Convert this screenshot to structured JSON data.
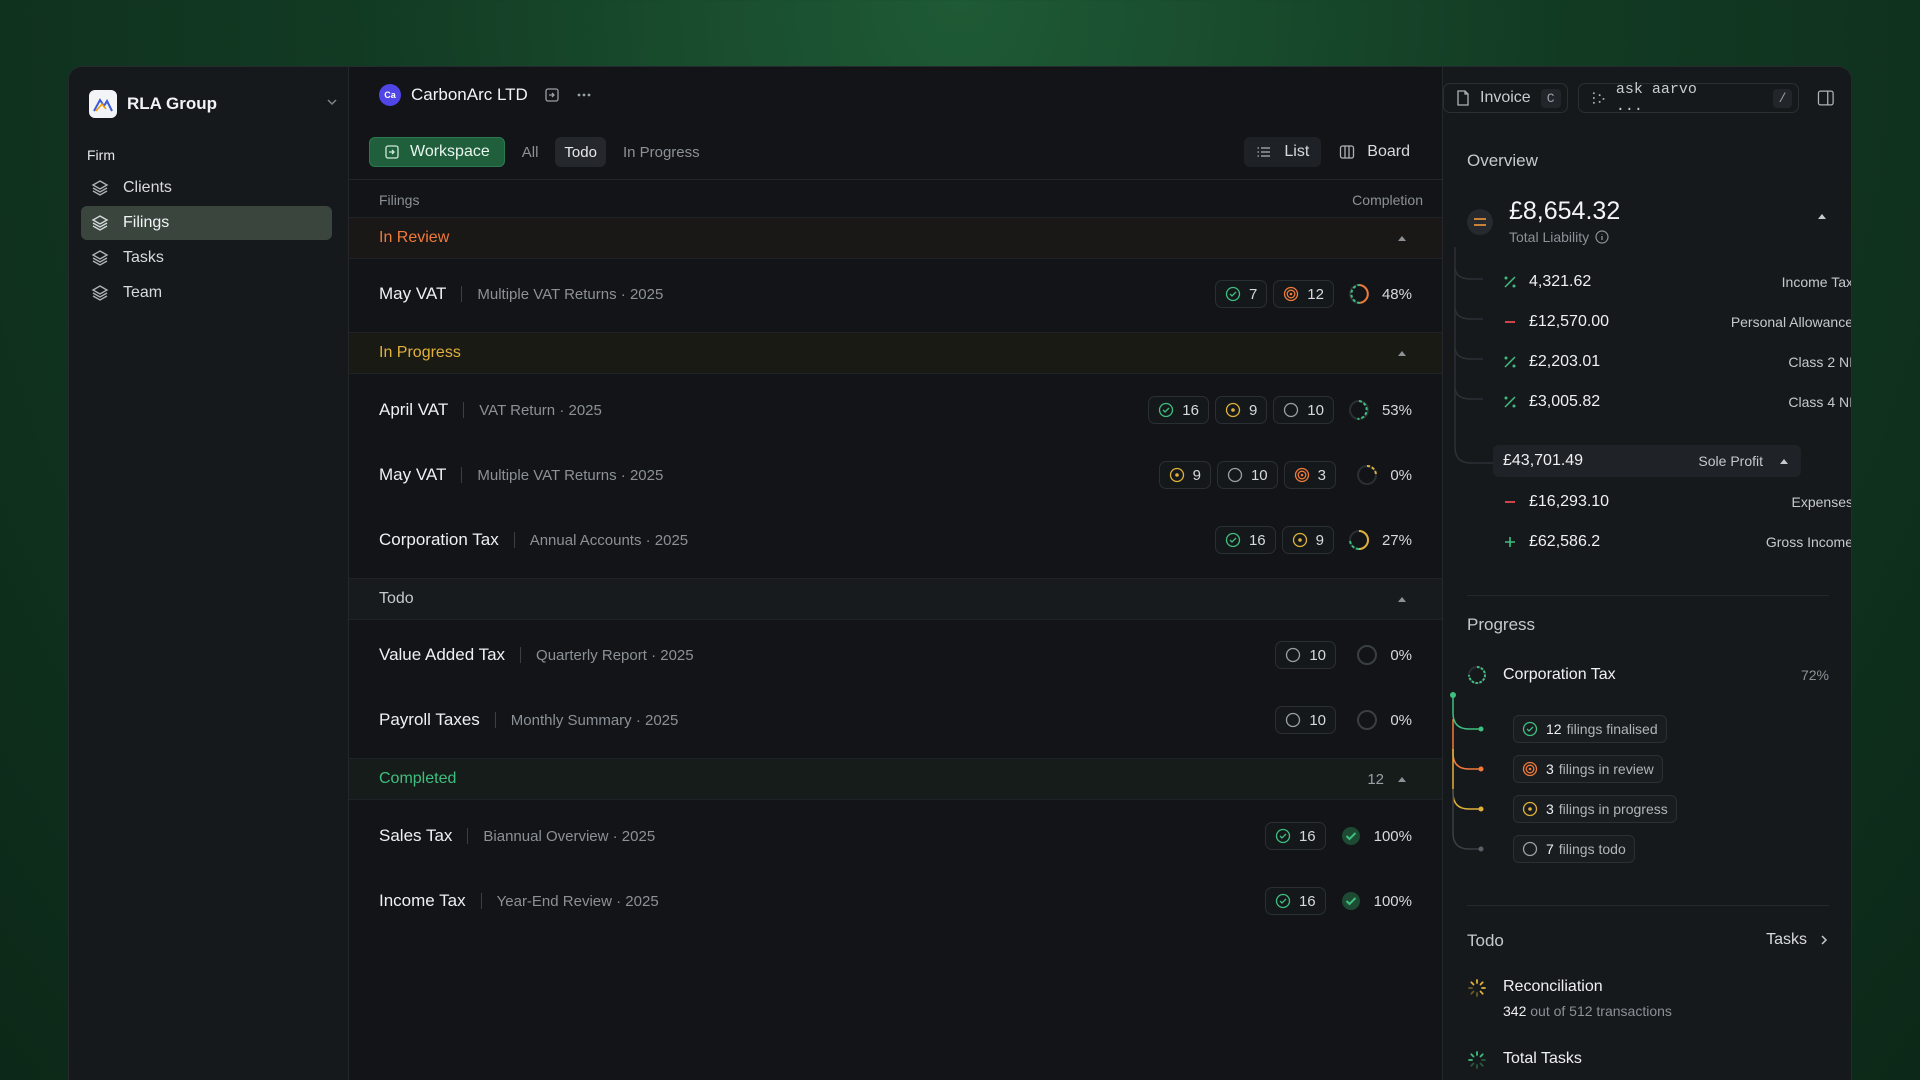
{
  "sidebar": {
    "org_name": "RLA Group",
    "section": "Firm",
    "items": [
      {
        "label": "Clients",
        "active": false
      },
      {
        "label": "Filings",
        "active": true
      },
      {
        "label": "Tasks",
        "active": false
      },
      {
        "label": "Team",
        "active": false
      }
    ]
  },
  "header": {
    "client_initials": "Ca",
    "client_name": "CarbonArc LTD",
    "invoice_label": "Invoice",
    "invoice_key": "C",
    "ask_placeholder": "ask aarvo ...",
    "ask_key": "/"
  },
  "tabs": {
    "workspace": "Workspace",
    "all": "All",
    "todo": "Todo",
    "in_progress": "In Progress"
  },
  "views": {
    "list": "List",
    "board": "Board"
  },
  "table": {
    "col_filings": "Filings",
    "col_completion": "Completion"
  },
  "groups": {
    "review": {
      "label": "In Review",
      "rows": [
        {
          "title": "May VAT",
          "sub": "Multiple VAT Returns · 2025",
          "done": "7",
          "review": "12",
          "pct": "48%"
        }
      ]
    },
    "progress": {
      "label": "In Progress",
      "rows": [
        {
          "title": "April VAT",
          "sub": "VAT Return · 2025",
          "done": "16",
          "prog": "9",
          "todo": "10",
          "pct": "53%"
        },
        {
          "title": "May VAT",
          "sub": "Multiple VAT Returns · 2025",
          "prog": "9",
          "todo": "10",
          "review": "3",
          "pct": "0%"
        },
        {
          "title": "Corporation Tax",
          "sub": "Annual Accounts · 2025",
          "done": "16",
          "prog": "9",
          "pct": "27%"
        }
      ]
    },
    "todo": {
      "label": "Todo",
      "rows": [
        {
          "title": "Value Added Tax",
          "sub": "Quarterly Report · 2025",
          "todo": "10",
          "pct": "0%"
        },
        {
          "title": "Payroll Taxes",
          "sub": "Monthly Summary · 2025",
          "todo": "10",
          "pct": "0%"
        }
      ]
    },
    "completed": {
      "label": "Completed",
      "count": "12",
      "rows": [
        {
          "title": "Sales Tax",
          "sub": "Biannual Overview · 2025",
          "done": "16",
          "pct": "100%"
        },
        {
          "title": "Income Tax",
          "sub": "Year-End Review · 2025",
          "done": "16",
          "pct": "100%"
        }
      ]
    }
  },
  "overview": {
    "title": "Overview",
    "total_amount": "£8,654.32",
    "total_label": "Total Liability",
    "lines": [
      {
        "amount": "4,321.62",
        "label": "Income Tax",
        "sign": "percent"
      },
      {
        "amount": "£12,570.00",
        "label": "Personal Allowance",
        "sign": "minus"
      },
      {
        "amount": "£2,203.01",
        "label": "Class 2 NI",
        "sign": "percent"
      },
      {
        "amount": "£3,005.82",
        "label": "Class 4 NI",
        "sign": "percent"
      }
    ],
    "sole_amount": "£43,701.49",
    "sole_label": "Sole Profit",
    "sub_lines": [
      {
        "amount": "£16,293.10",
        "label": "Expenses",
        "sign": "minus"
      },
      {
        "amount": "£62,586.2",
        "label": "Gross Income",
        "sign": "plus"
      }
    ]
  },
  "progress": {
    "title": "Progress",
    "item": "Corporation Tax",
    "pct": "72%",
    "chips": [
      {
        "count": "12",
        "text": "filings finalised"
      },
      {
        "count": "3",
        "text": "filings in review"
      },
      {
        "count": "3",
        "text": "filings in progress"
      },
      {
        "count": "7",
        "text": "filings todo"
      }
    ]
  },
  "todo_panel": {
    "title": "Todo",
    "link": "Tasks",
    "items": [
      {
        "title": "Reconciliation",
        "count": "342",
        "rest": "out of 512 transactions"
      },
      {
        "title": "Total Tasks"
      }
    ]
  },
  "colors": {
    "accent_green": "#1f5f3c",
    "review": "#f07a3a",
    "progress": "#e0b13a",
    "done": "#3fbf7f"
  }
}
